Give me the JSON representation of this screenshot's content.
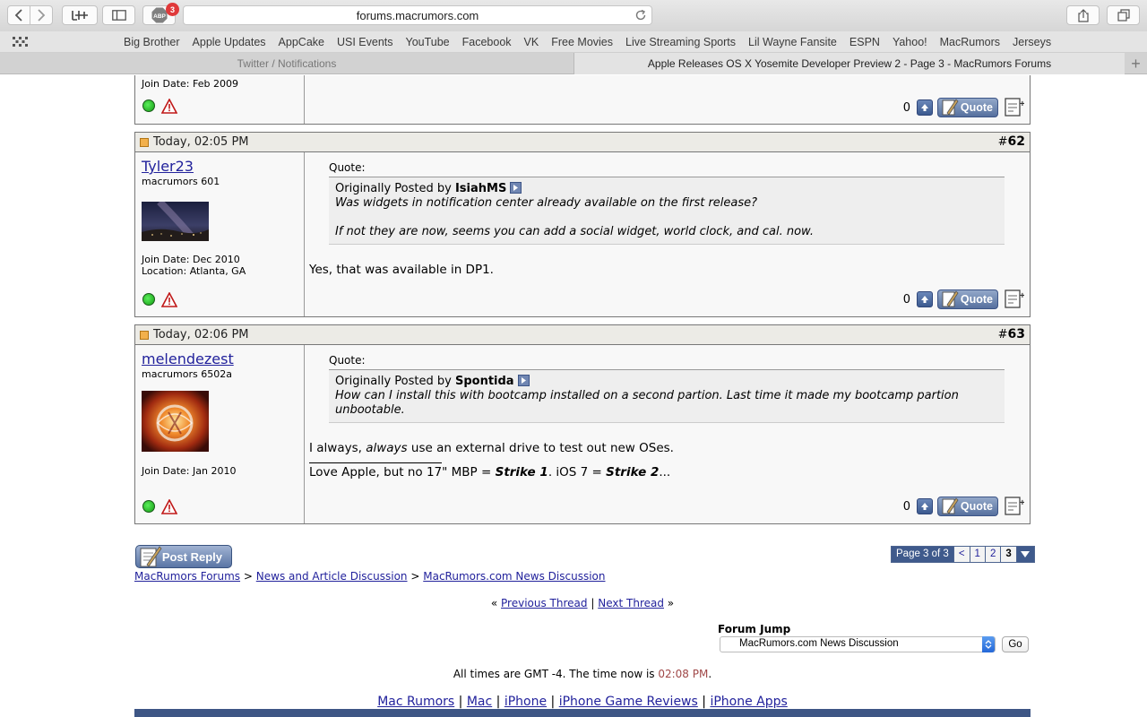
{
  "browser": {
    "url": "forums.macrumors.com",
    "adblock_badge_count": "3",
    "abp_label": "ABP",
    "favorites": [
      "Big Brother",
      "Apple Updates",
      "AppCake",
      "USI Events",
      "YouTube",
      "Facebook",
      "VK",
      "Free Movies",
      "Live Streaming Sports",
      "Lil Wayne Fansite",
      "ESPN",
      "Yahoo!",
      "MacRumors",
      "Jerseys"
    ],
    "tabs": [
      {
        "label": "Twitter / Notifications",
        "active": false
      },
      {
        "label": "Apple Releases OS X Yosemite Developer Preview 2 - Page 3 - MacRumors Forums",
        "active": true
      }
    ]
  },
  "prev_post": {
    "join_date": "Join Date: Feb 2009",
    "votes": "0",
    "quote_label": "Quote"
  },
  "posts": [
    {
      "date": "Today, 02:05 PM",
      "hash": "#",
      "number": "62",
      "username": "Tyler23",
      "user_title": "macrumors 601",
      "join_date": "Join Date: Dec 2010",
      "location": "Location: Atlanta, GA",
      "quote_label": "Quote:",
      "quote_prefix": "Originally Posted by ",
      "quote_author": "IsiahMS",
      "quote_lines": [
        "Was widgets in notification center already available on the first release?",
        "If not they are now, seems you can add a social widget, world clock, and cal. now."
      ],
      "message": "Yes, that was available in DP1.",
      "votes": "0",
      "quote_button": "Quote"
    },
    {
      "date": "Today, 02:06 PM",
      "hash": "#",
      "number": "63",
      "username": "melendezest",
      "user_title": "macrumors 6502a",
      "join_date": "Join Date: Jan 2010",
      "quote_label": "Quote:",
      "quote_prefix": "Originally Posted by ",
      "quote_author": "Spontida",
      "quote_lines": [
        "How can I install this with bootcamp installed on a second partion. Last time it made my bootcamp partion unbootable."
      ],
      "message_part1": "I always, ",
      "message_em": "always",
      "message_part2": " use an external drive to test out new OSes.",
      "signature_part1": "Love Apple, but no 17\" MBP = ",
      "signature_strike1": "Strike 1",
      "signature_part2": ". iOS 7 = ",
      "signature_strike2": "Strike 2",
      "signature_part3": "...",
      "votes": "0",
      "quote_button": "Quote"
    }
  ],
  "post_reply": "Post Reply",
  "pagination": {
    "label": "Page 3 of 3",
    "prev": "<",
    "pages": [
      "1",
      "2",
      "3"
    ],
    "current": "3"
  },
  "breadcrumb": [
    "MacRumors Forums",
    "News and Article Discussion",
    "MacRumors.com News Discussion"
  ],
  "breadcrumb_sep": ">",
  "thread_nav": {
    "left_quote": "«",
    "previous": "Previous Thread",
    "sep": "|",
    "next": "Next Thread",
    "right_quote": "»"
  },
  "forum_jump": {
    "label": "Forum Jump",
    "selected": "MacRumors.com News Discussion",
    "go": "Go"
  },
  "time_notice": {
    "prefix": "All times are GMT -4. The time now is ",
    "now": "02:08 PM",
    "suffix": "."
  },
  "footer_links": [
    "Mac Rumors",
    "Mac",
    "iPhone",
    "iPhone Game Reviews",
    "iPhone Apps"
  ],
  "footer_sep": "|"
}
